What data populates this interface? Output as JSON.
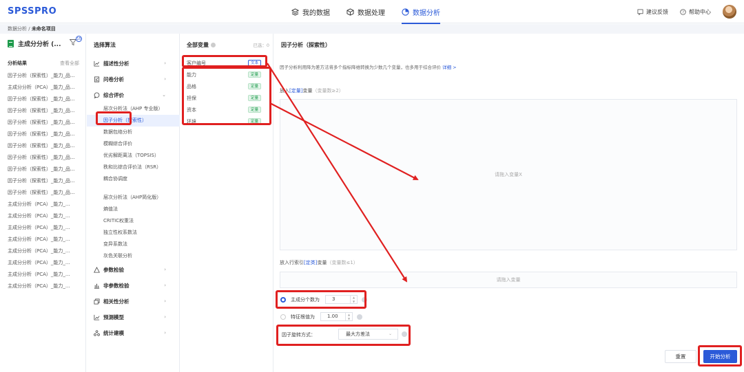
{
  "app": {
    "logo": "SPSSPRO"
  },
  "nav": {
    "tabs": [
      {
        "label": "我的数据"
      },
      {
        "label": "数据处理"
      },
      {
        "label": "数据分析"
      }
    ],
    "feedback": "建议反馈",
    "help": "帮助中心"
  },
  "breadcrumb": {
    "root": "数据分析",
    "sep": " / ",
    "current": "未命名项目"
  },
  "left": {
    "project": "主成分分析 (...",
    "badge": "15",
    "results_title": "分析结果",
    "view_all": "查看全部",
    "results": [
      "因子分析（探索性）_能力_品...",
      "主成分分析（PCA）_能力_品...",
      "因子分析（探索性）_能力_品...",
      "因子分析（探索性）_能力_品...",
      "因子分析（探索性）_能力_品...",
      "因子分析（探索性）_能力_品...",
      "因子分析（探索性）_能力_品...",
      "因子分析（探索性）_能力_品...",
      "因子分析（探索性）_能力_品...",
      "因子分析（探索性）_能力_品...",
      "因子分析（探索性）_能力_品...",
      "主成分分析（PCA）_能力_...",
      "主成分分析（PCA）_能力_...",
      "主成分分析（PCA）_能力_...",
      "主成分分析（PCA）_能力_...",
      "主成分分析（PCA）_能力_...",
      "主成分分析（PCA）_能力_...",
      "主成分分析（PCA）_能力_...",
      "主成分分析（PCA）_能力_..."
    ]
  },
  "algorithms": {
    "title": "选择算法",
    "cat_desc": "描述性分析",
    "cat_survey": "问卷分析",
    "cat_comp": "综合评价",
    "sub1": [
      "层次分析法（AHP 专业版）",
      "因子分析（探索性）",
      "数据包络分析",
      "模糊综合评价",
      "优劣解距离法（TOPSIS）",
      "秩和比综合评价法（RSR）",
      "耦合协调度"
    ],
    "sub2": [
      "层次分析法（AHP简化版）",
      "熵值法",
      "CRITIC权重法",
      "独立性权系数法",
      "变异系数法",
      "灰色关联分析"
    ],
    "cat_param": "参数检验",
    "cat_nonparam": "非参数检验",
    "cat_corr": "相关性分析",
    "cat_pred": "预测模型",
    "cat_stat": "统计建模"
  },
  "variables": {
    "title": "全部变量",
    "selected": "已选：0",
    "items": [
      {
        "name": "客户编号",
        "tag": "文本",
        "kind": "txt"
      },
      {
        "name": "能力",
        "tag": "定量",
        "kind": "num"
      },
      {
        "name": "品格",
        "tag": "定量",
        "kind": "num"
      },
      {
        "name": "担保",
        "tag": "定量",
        "kind": "num"
      },
      {
        "name": "资本",
        "tag": "定量",
        "kind": "num"
      },
      {
        "name": "环境",
        "tag": "定量",
        "kind": "num"
      }
    ]
  },
  "main": {
    "title": "因子分析（探索性）",
    "desc": "因子分析利用降为差方法将多个指标降维转换为少数几个变量，也多用于综合评价",
    "detail_link": "详细 >",
    "x_label_a": "放入",
    "x_label_tag": "[定量]",
    "x_label_b": "变量",
    "x_count": "（变量数≥2）",
    "x_placeholder": "请拖入变量X",
    "idx_label_a": "放入行索引",
    "idx_label_tag": "[定类]",
    "idx_label_b": "变量",
    "idx_count": "（变量数≤1）",
    "idx_placeholder": "请拖入变量",
    "opt_factors_label": "主成分个数为",
    "opt_factors_value": "3",
    "opt_eigen_label": "特征根值为",
    "opt_eigen_value": "1.00",
    "rotation_label": "因子旋转方式：",
    "rotation_value": "最大方差法",
    "reset": "重置",
    "run": "开始分析"
  }
}
